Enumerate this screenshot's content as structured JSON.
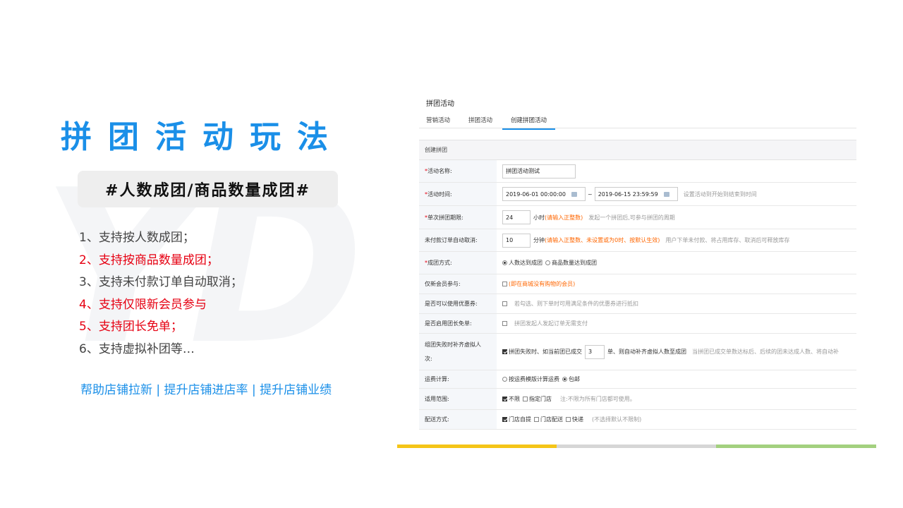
{
  "watermark": "YD",
  "title": "拼团活动玩法",
  "tag": "#人数成团/商品数量成团#",
  "features": [
    {
      "text": "1、支持按人数成团；",
      "highlight": false
    },
    {
      "text": "2、支持按商品数量成团；",
      "highlight": true
    },
    {
      "text": "3、支持未付款订单自动取消；",
      "highlight": false
    },
    {
      "text": "4、支持仅限新会员参与",
      "highlight": true
    },
    {
      "text": "5、支持团长免单；",
      "highlight": true
    },
    {
      "text": "6、支持虚拟补团等…",
      "highlight": false
    }
  ],
  "slogan": "帮助店铺拉新 | 提升店铺进店率 | 提升店铺业绩",
  "screenshot": {
    "page_title": "拼团活动",
    "tabs": [
      "营销活动",
      "拼团活动",
      "创建拼团活动"
    ],
    "active_tab": "创建拼团活动",
    "section_title": "创建拼团",
    "fields": {
      "name": {
        "label": "活动名称:",
        "value": "拼团活动测试"
      },
      "time": {
        "label": "活动时间:",
        "start": "2019-06-01 00:00:00",
        "sep": "~",
        "end": "2019-06-15 23:59:59",
        "hint": "设置活动到开始到结束到时间"
      },
      "period": {
        "label": "单次拼团期限:",
        "value": "24",
        "unit": "小时",
        "warn": "(请输入正整数)",
        "hint": "发起一个拼团后,可参与拼团的周期"
      },
      "cancel": {
        "label": "未付款订单自动取消:",
        "value": "10",
        "unit": "分钟",
        "warn": "(请输入正整数、未设置或为0时、按默认生效)",
        "hint": "用户下单未付款、将占用库存、取消后可释放库存"
      },
      "mode": {
        "label": "成团方式:",
        "options": [
          "人数达到成团",
          "商品数量达到成团"
        ]
      },
      "newmember": {
        "label": "仅新会员参与:",
        "text": "(即在商城没有购物的会员)"
      },
      "coupon": {
        "label": "是否可以使用优惠券:",
        "hint": "若勾选、则下单时可用满足条件的优惠券进行抵扣"
      },
      "leader": {
        "label": "是否启用团长免单:",
        "hint": "拼团发起人发起订单无需支付"
      },
      "virtual": {
        "label": "组团失败时补齐虚拟人次:",
        "pre": "拼团失败时、如当前团已成交",
        "value": "3",
        "post": "单、则自动补齐虚拟人数至成团",
        "hint": "当拼团已成交单数达标后、后续的团未达成人数、将自动补"
      },
      "freight": {
        "label": "运费计算:",
        "options": [
          "按运费模版计算运费",
          "包邮"
        ]
      },
      "scope": {
        "label": "适用范围:",
        "options": [
          "不限",
          "指定门店"
        ],
        "hint": "注:不限为所有门店都可使用。"
      },
      "delivery": {
        "label": "配送方式:",
        "options": [
          "门店自提",
          "门店配送",
          "快递"
        ],
        "hint": "(不选择默认不限制)"
      }
    }
  },
  "colors": {
    "accent": "#1a8fe8",
    "highlight": "#e60012",
    "bar_yellow": "#f5c518",
    "bar_gray": "#d6d6d6",
    "bar_green": "#a3d07f"
  }
}
